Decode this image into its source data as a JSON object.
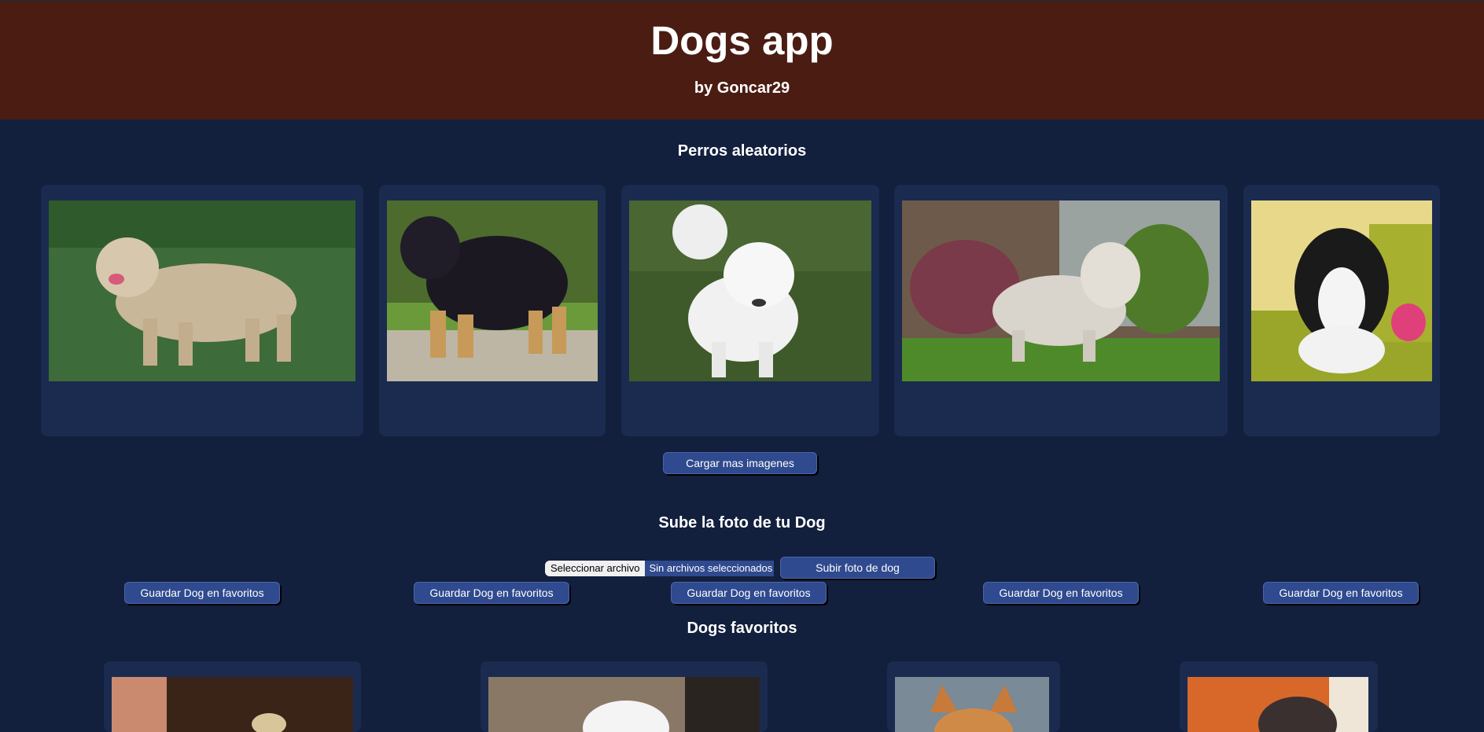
{
  "header": {
    "title": "Dogs app",
    "subtitle": "by Goncar29"
  },
  "random": {
    "title": "Perros aleatorios",
    "save_label": "Guardar Dog en favoritos",
    "load_more_label": "Cargar mas imagenes",
    "cards": [
      {
        "photo": "terrier-on-grass-photo"
      },
      {
        "photo": "black-tan-mastiff-photo"
      },
      {
        "photo": "white-spitz-photo"
      },
      {
        "photo": "shih-tzu-photo"
      },
      {
        "photo": "border-collie-on-sofa-photo"
      }
    ]
  },
  "upload": {
    "title": "Sube la foto de tu Dog",
    "choose_file_label": "Seleccionar archivo",
    "no_file_label": "Sin archivos seleccionados",
    "submit_label": "Subir foto de dog"
  },
  "favorites": {
    "title": "Dogs favoritos",
    "cards": [
      {
        "photo": "dog-on-leather-couch-photo"
      },
      {
        "photo": "white-fluffy-dog-photo"
      },
      {
        "photo": "shiba-inu-photo"
      },
      {
        "photo": "dog-on-orange-blanket-photo"
      }
    ]
  },
  "colors": {
    "header_bg": "#4a1c12",
    "page_bg": "#121f3d",
    "card_bg": "#1a2b4f",
    "button_bg": "#2f4a8e"
  }
}
